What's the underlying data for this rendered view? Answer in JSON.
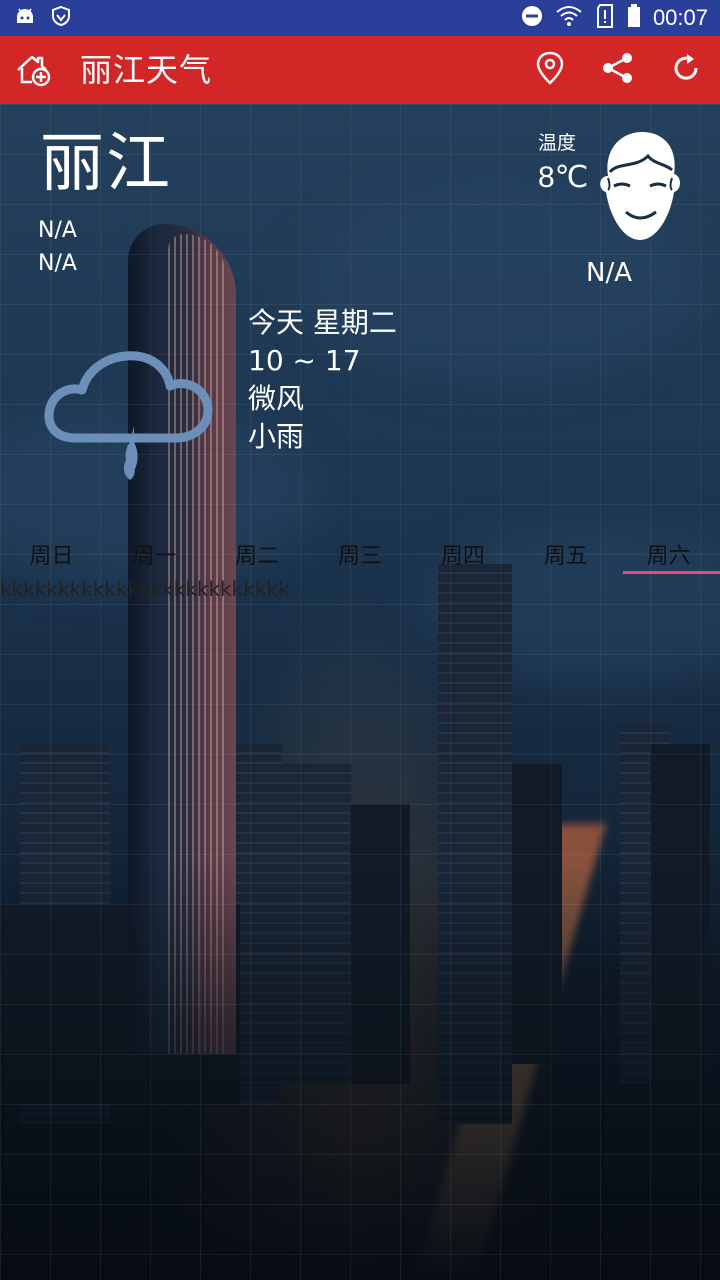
{
  "status_bar": {
    "time": "00:07",
    "left_icons": [
      "android-icon",
      "shield-icon"
    ],
    "right_icons": [
      "do-not-disturb-icon",
      "wifi-icon",
      "sim-alert-icon",
      "battery-icon"
    ]
  },
  "app_bar": {
    "title": "丽江天气",
    "icons": [
      "add-home-icon",
      "location-pin-icon",
      "share-icon",
      "refresh-icon"
    ],
    "background_color": "#d32626"
  },
  "current": {
    "city": "丽江",
    "info_line_1": "N/A",
    "info_line_2": "N/A",
    "temp_label": "温度",
    "temp_value": "8℃",
    "face_status": "N/A"
  },
  "today": {
    "day": "今天 星期二",
    "range": "10 ~ 17",
    "wind": "微风",
    "condition": "小雨",
    "icon": "rain-cloud-icon"
  },
  "week_tabs": [
    {
      "label": "周日",
      "active": false
    },
    {
      "label": "周一",
      "active": false
    },
    {
      "label": "周二",
      "active": false
    },
    {
      "label": "周三",
      "active": false
    },
    {
      "label": "周四",
      "active": false
    },
    {
      "label": "周五",
      "active": false
    },
    {
      "label": "周六",
      "active": true
    }
  ],
  "ticker_text": "kkkkkkkkkkkkkkkkkkkkkkkkk",
  "accent_color": "#e8497a"
}
